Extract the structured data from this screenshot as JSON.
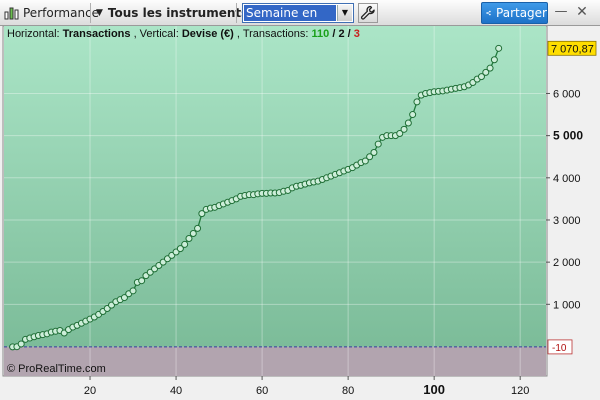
{
  "toolbar": {
    "performance_label": "Performance",
    "instrument_label": "Tous les instruments",
    "period_value": "Semaine en cours",
    "share_label": "Partager",
    "minimize_glyph": "—",
    "close_glyph": "✕"
  },
  "icons": {
    "performance": "bar-chart-icon",
    "instrument_caret": "caret-down-icon",
    "period_arrow": "caret-down-icon",
    "settings": "wrench-icon",
    "share": "share-icon",
    "minimize": "minimize-icon",
    "close": "close-icon"
  },
  "header": {
    "horizontal_label": "Horizontal: ",
    "horizontal_value": "Transactions",
    "vertical_label": ", Vertical: ",
    "vertical_value": "Devise (€)",
    "transactions_label": ", Transactions: ",
    "winning": "110",
    "neutral": "2",
    "losing": "3",
    "slash": " / "
  },
  "watermark": "© ProRealTime.com",
  "colors": {
    "positive_area_top": "#abe5c7",
    "positive_area_bottom": "#7cbc99",
    "negative_area": "#b2a4af",
    "line": "#217a3c",
    "marker_stroke": "#1f6e36",
    "marker_fill": "#cdeed9",
    "winning_text": "#1aa01a",
    "losing_text": "#c8201e",
    "last_value_badge": "#ffde00"
  },
  "chart_data": {
    "type": "line",
    "x": [
      2,
      3,
      4,
      5,
      6,
      7,
      8,
      9,
      10,
      11,
      12,
      13,
      14,
      15,
      16,
      17,
      18,
      19,
      20,
      21,
      22,
      23,
      24,
      25,
      26,
      27,
      28,
      29,
      30,
      31,
      32,
      33,
      34,
      35,
      36,
      37,
      38,
      39,
      40,
      41,
      42,
      43,
      44,
      45,
      46,
      47,
      48,
      49,
      50,
      51,
      52,
      53,
      54,
      55,
      56,
      57,
      58,
      59,
      60,
      61,
      62,
      63,
      64,
      65,
      66,
      67,
      68,
      69,
      70,
      71,
      72,
      73,
      74,
      75,
      76,
      77,
      78,
      79,
      80,
      81,
      82,
      83,
      84,
      85,
      86,
      87,
      88,
      89,
      90,
      91,
      92,
      93,
      94,
      95,
      96,
      97,
      98,
      99,
      100,
      101,
      102,
      103,
      104,
      105,
      106,
      107,
      108,
      109,
      110,
      111,
      112,
      113,
      114,
      115
    ],
    "y": [
      -10,
      -5,
      60,
      170,
      200,
      230,
      260,
      280,
      300,
      340,
      360,
      380,
      320,
      400,
      460,
      500,
      550,
      600,
      650,
      700,
      760,
      830,
      900,
      980,
      1060,
      1110,
      1160,
      1250,
      1320,
      1520,
      1560,
      1680,
      1760,
      1840,
      1920,
      2000,
      2080,
      2160,
      2240,
      2320,
      2420,
      2560,
      2680,
      2800,
      3150,
      3250,
      3280,
      3300,
      3340,
      3380,
      3420,
      3460,
      3500,
      3560,
      3580,
      3600,
      3600,
      3620,
      3630,
      3630,
      3640,
      3640,
      3650,
      3680,
      3700,
      3760,
      3800,
      3820,
      3850,
      3880,
      3900,
      3920,
      3960,
      4000,
      4040,
      4080,
      4120,
      4160,
      4200,
      4240,
      4300,
      4360,
      4400,
      4500,
      4600,
      4800,
      4960,
      5000,
      5000,
      5000,
      5050,
      5150,
      5300,
      5500,
      5800,
      5960,
      6000,
      6020,
      6040,
      6050,
      6060,
      6080,
      6100,
      6120,
      6140,
      6160,
      6200,
      6260,
      6340,
      6400,
      6500,
      6600,
      6800,
      7070.87
    ],
    "xlim": [
      0,
      126
    ],
    "ylim": [
      -700,
      7600
    ],
    "x_ticks": [
      20,
      40,
      60,
      80,
      100,
      120
    ],
    "x_ticks_bold": [
      100
    ],
    "y_ticks": [
      1000,
      2000,
      3000,
      4000,
      5000,
      6000
    ],
    "y_tick_labels": [
      "1 000",
      "2 000",
      "3 000",
      "4 000",
      "5 000",
      "6 000"
    ],
    "y_ticks_bold": [
      5000
    ],
    "last_value": 7070.87,
    "last_value_label": "7 070,87",
    "baseline_value": -10,
    "baseline_label": "-10",
    "grid": true
  }
}
